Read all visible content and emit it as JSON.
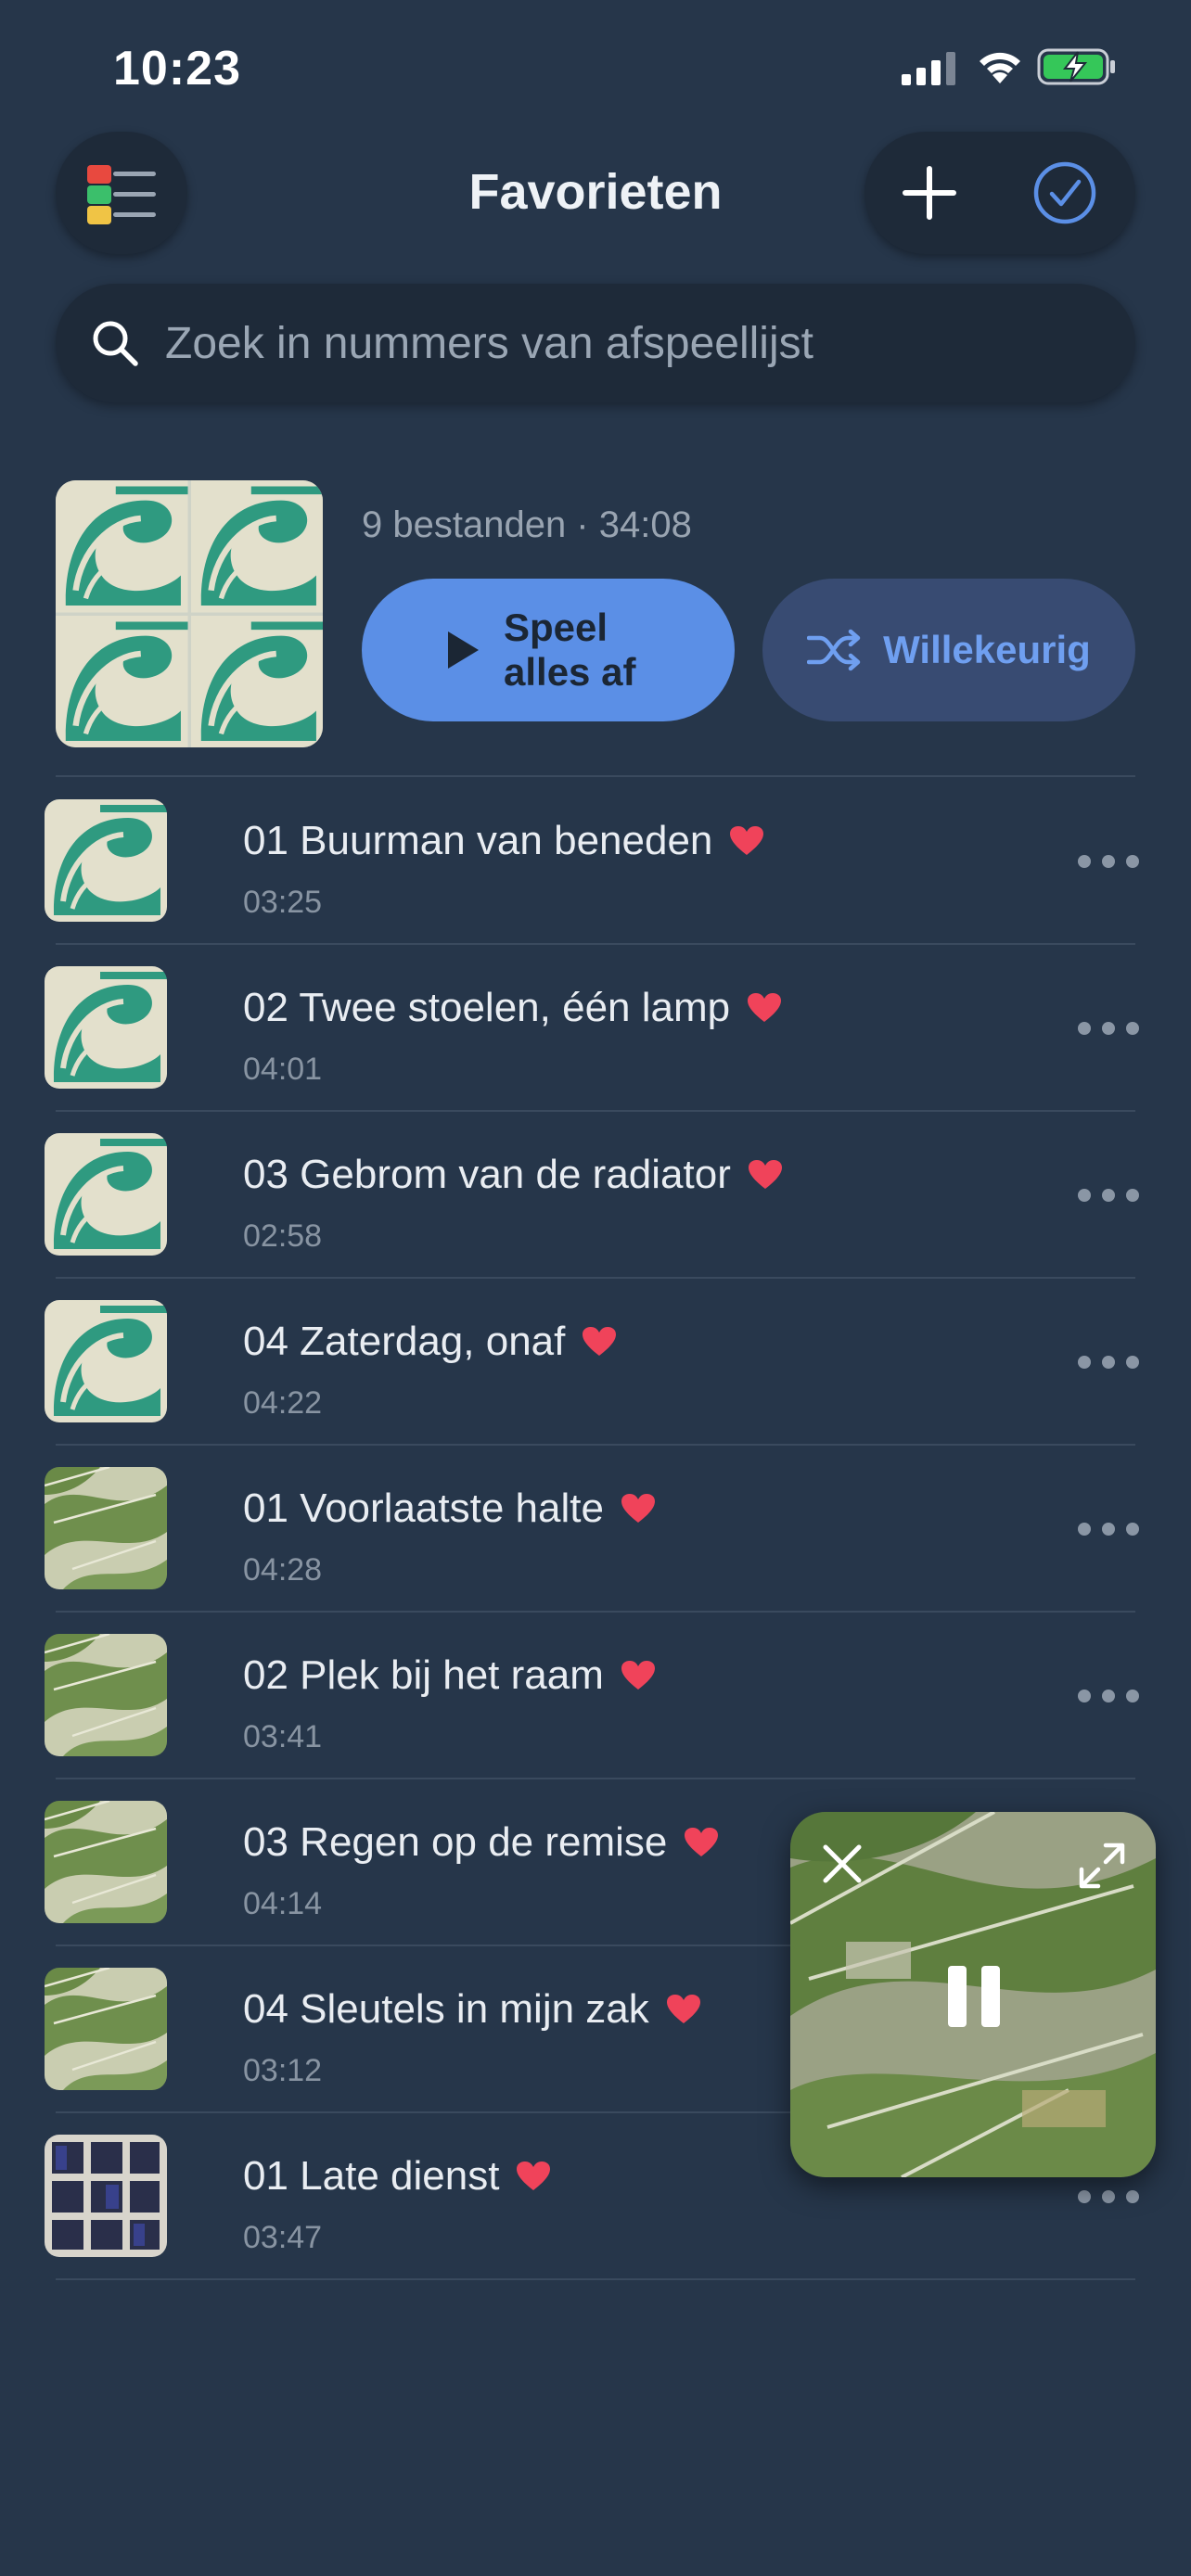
{
  "status_bar": {
    "time": "10:23"
  },
  "header": {
    "title": "Favorieten"
  },
  "search": {
    "placeholder": "Zoek in nummers van afspeellijst",
    "value": ""
  },
  "playlist": {
    "meta": "9 bestanden · 34:08",
    "play_all_label": "Speel\nalles af",
    "shuffle_label": "Willekeurig"
  },
  "tracks": [
    {
      "title": "01 Buurman van beneden",
      "duration": "03:25",
      "art": "wave"
    },
    {
      "title": "02 Twee stoelen, één lamp",
      "duration": "04:01",
      "art": "wave"
    },
    {
      "title": "03 Gebrom van de radiator",
      "duration": "02:58",
      "art": "wave"
    },
    {
      "title": "04 Zaterdag, onaf",
      "duration": "04:22",
      "art": "wave"
    },
    {
      "title": "01 Voorlaatste halte",
      "duration": "04:28",
      "art": "leaves"
    },
    {
      "title": "02 Plek bij het raam",
      "duration": "03:41",
      "art": "leaves"
    },
    {
      "title": "03 Regen op de remise",
      "duration": "04:14",
      "art": "leaves"
    },
    {
      "title": "04 Sleutels in mijn zak",
      "duration": "03:12",
      "art": "leaves"
    },
    {
      "title": "01 Late dienst",
      "duration": "03:47",
      "art": "windows"
    }
  ],
  "colors": {
    "accent": "#5b8fe6",
    "heart": "#f0435a",
    "background": "#26364a"
  }
}
